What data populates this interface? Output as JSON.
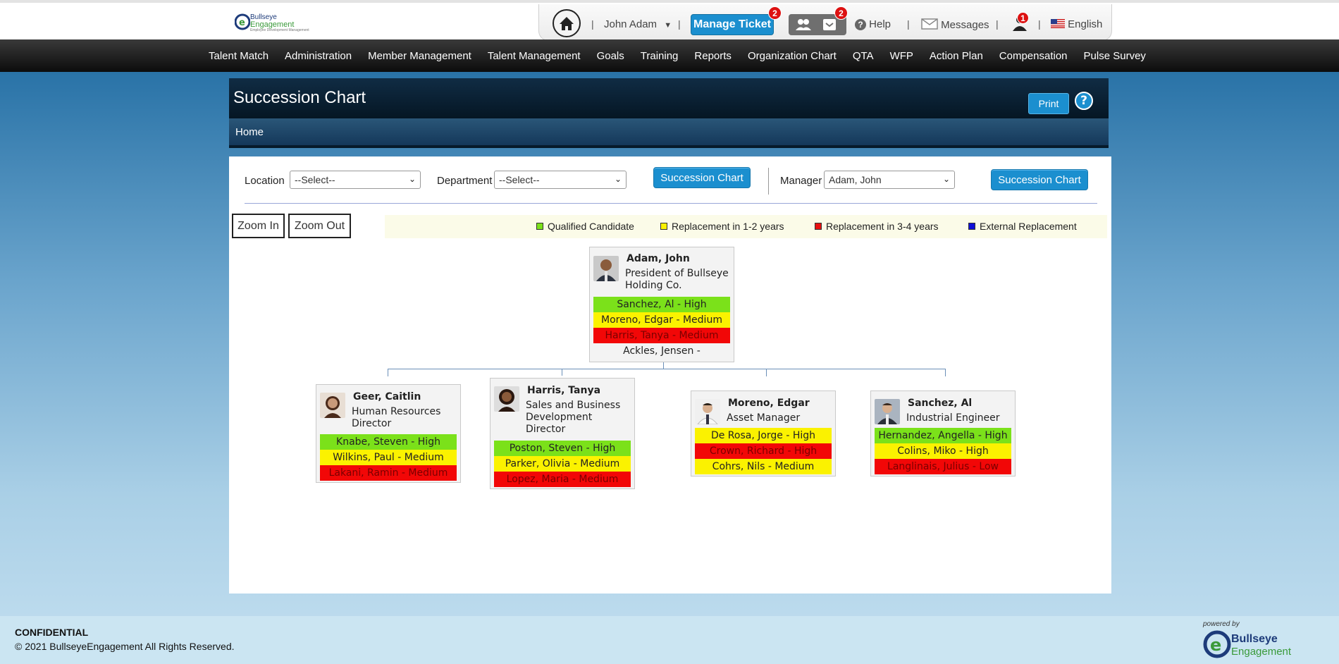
{
  "header": {
    "logo": {
      "line1": "Bullseye",
      "line2": "Engagement",
      "line3": "Employee Development Management"
    },
    "user_name": "John Adam",
    "manage_ticket": "Manage Ticket",
    "manage_ticket_badge": "2",
    "inbox_badge": "2",
    "help": "Help",
    "messages": "Messages",
    "alert_badge": "1",
    "language": "English"
  },
  "nav": [
    "Talent Match",
    "Administration",
    "Member Management",
    "Talent Management",
    "Goals",
    "Training",
    "Reports",
    "Organization Chart",
    "QTA",
    "WFP",
    "Action Plan",
    "Compensation",
    "Pulse Survey"
  ],
  "page": {
    "title": "Succession Chart",
    "print": "Print",
    "help_glyph": "?",
    "breadcrumb": "Home"
  },
  "filters": {
    "location_label": "Location",
    "location_value": "--Select--",
    "department_label": "Department",
    "department_value": "--Select--",
    "button1": "Succession Chart",
    "manager_label": "Manager",
    "manager_value": "Adam, John",
    "button2": "Succession Chart"
  },
  "zoom": {
    "in": "Zoom In",
    "out": "Zoom Out"
  },
  "legend": [
    {
      "label": "Qualified Candidate",
      "color": "#7be11a"
    },
    {
      "label": "Replacement in 1-2 years",
      "color": "#fbf200"
    },
    {
      "label": "Replacement in 3-4 years",
      "color": "#e81010"
    },
    {
      "label": "External Replacement",
      "color": "#1010d8"
    }
  ],
  "org": {
    "root": {
      "name": "Adam, John",
      "title": "President of Bullseye Holding Co.",
      "candidates": [
        {
          "text": "Sanchez, Al - High",
          "status": "green"
        },
        {
          "text": "Moreno, Edgar - Medium",
          "status": "yellow"
        },
        {
          "text": "Harris, Tanya - Medium",
          "status": "red"
        },
        {
          "text": "Ackles, Jensen -",
          "status": "none"
        }
      ]
    },
    "children": [
      {
        "name": "Geer, Caitlin",
        "title": "Human Resources Director",
        "candidates": [
          {
            "text": "Knabe, Steven - High",
            "status": "green"
          },
          {
            "text": "Wilkins, Paul - Medium",
            "status": "yellow"
          },
          {
            "text": "Lakani, Ramin - Medium",
            "status": "red"
          }
        ]
      },
      {
        "name": "Harris, Tanya",
        "title": "Sales and Business Development Director",
        "candidates": [
          {
            "text": "Poston, Steven - High",
            "status": "green"
          },
          {
            "text": "Parker, Olivia - Medium",
            "status": "yellow"
          },
          {
            "text": "Lopez, Maria - Medium",
            "status": "red"
          }
        ]
      },
      {
        "name": "Moreno, Edgar",
        "title": "Asset Manager",
        "candidates": [
          {
            "text": "De Rosa, Jorge - High",
            "status": "yellow"
          },
          {
            "text": "Crown, Richard - High",
            "status": "red"
          },
          {
            "text": "Cohrs, Nils - Medium",
            "status": "yellow"
          }
        ]
      },
      {
        "name": "Sanchez, Al",
        "title": "Industrial Engineer",
        "candidates": [
          {
            "text": "Hernandez, Angella - High",
            "status": "green"
          },
          {
            "text": "Colins, Miko - High",
            "status": "yellow"
          },
          {
            "text": "Langlinais, Julius - Low",
            "status": "red"
          }
        ]
      }
    ]
  },
  "footer": {
    "confidential": "CONFIDENTIAL",
    "copyright": "© 2021 BullseyeEngagement All Rights Reserved.",
    "powered_by": "powered by",
    "brand1": "Bullseye",
    "brand2": "Engagement"
  }
}
